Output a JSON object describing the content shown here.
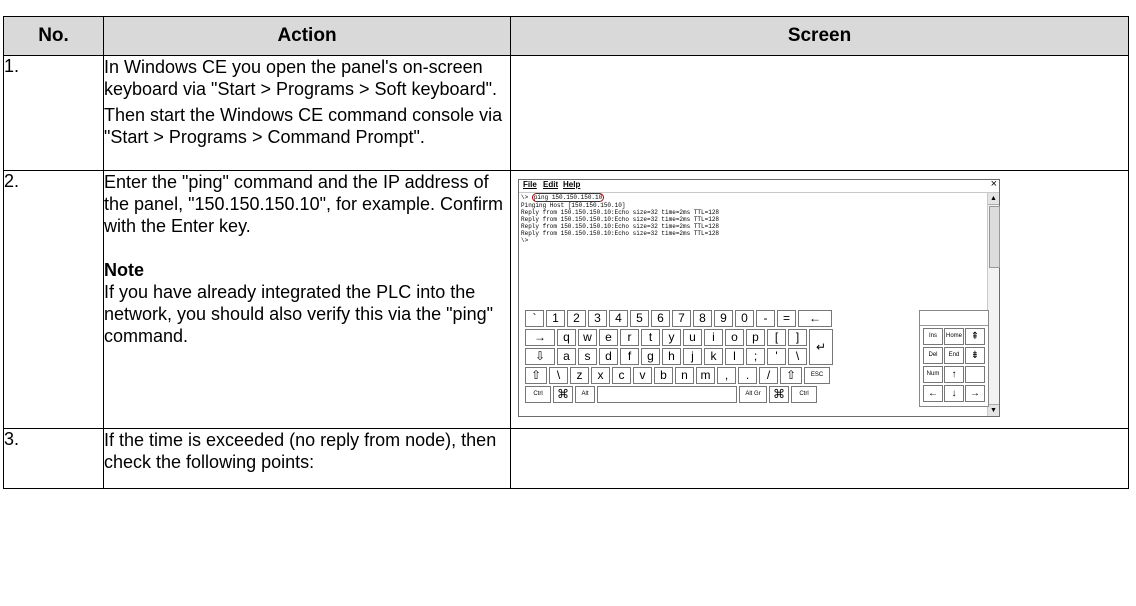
{
  "table": {
    "headers": [
      "No.",
      "Action",
      "Screen"
    ],
    "rows": [
      {
        "no": "1.",
        "paragraphs": [
          "In Windows CE you open the panel's on-screen keyboard via \"Start > Programs > Soft keyboard\".",
          "Then start the Windows CE command console via \"Start > Programs > Command Prompt\"."
        ]
      },
      {
        "no": "2.",
        "paragraphs": [
          "Enter the \"ping\" command and the IP address of the panel, \"150.150.150.10\", for example. Confirm with the Enter key."
        ],
        "note_heading": "Note",
        "note_text": "If you have already integrated the PLC into the network, you should also verify this via the \"ping\" command."
      },
      {
        "no": "3.",
        "paragraphs": [
          "If the time is exceeded (no reply from node), then check the following points:"
        ]
      }
    ]
  },
  "screen": {
    "menu": [
      "File",
      "Edit",
      "Help"
    ],
    "close_glyph": "×",
    "prompt": "\\> ",
    "command": "ping 150.150.150.10",
    "output_lines": [
      "Pinging Host [150.150.150.10]",
      "Reply from 150.150.150.10:Echo size=32 time=2ms TTL=128",
      "Reply from 150.150.150.10:Echo size=32 time=2ms TTL=128",
      "Reply from 150.150.150.10:Echo size=32 time=2ms TTL=128",
      "Reply from 150.150.150.10:Echo size=32 time=2ms TTL=128",
      "\\>"
    ],
    "scroll_up": "▲",
    "scroll_down": "▼",
    "keyboard_rows": [
      [
        "`",
        "1",
        "2",
        "3",
        "4",
        "5",
        "6",
        "7",
        "8",
        "9",
        "0",
        "-",
        "=",
        "←"
      ],
      [
        "→",
        "q",
        "w",
        "e",
        "r",
        "t",
        "y",
        "u",
        "i",
        "o",
        "p",
        "[",
        "]",
        "↵"
      ],
      [
        "⇩",
        "a",
        "s",
        "d",
        "f",
        "g",
        "h",
        "j",
        "k",
        "l",
        ";",
        "'",
        "\\"
      ],
      [
        "⇧",
        "\\",
        "z",
        "x",
        "c",
        "v",
        "b",
        "n",
        "m",
        ",",
        ".",
        "/",
        "⇧",
        "ESC"
      ],
      [
        "Ctrl",
        "⌘",
        "Alt",
        "",
        "Alt Gr",
        "⌘",
        "Ctrl"
      ]
    ],
    "keypad_keys": [
      "Ins",
      "Home",
      "⇞",
      "Del",
      "End",
      "⇟",
      "Num",
      "↑",
      "",
      "←",
      "↓",
      "→"
    ]
  }
}
